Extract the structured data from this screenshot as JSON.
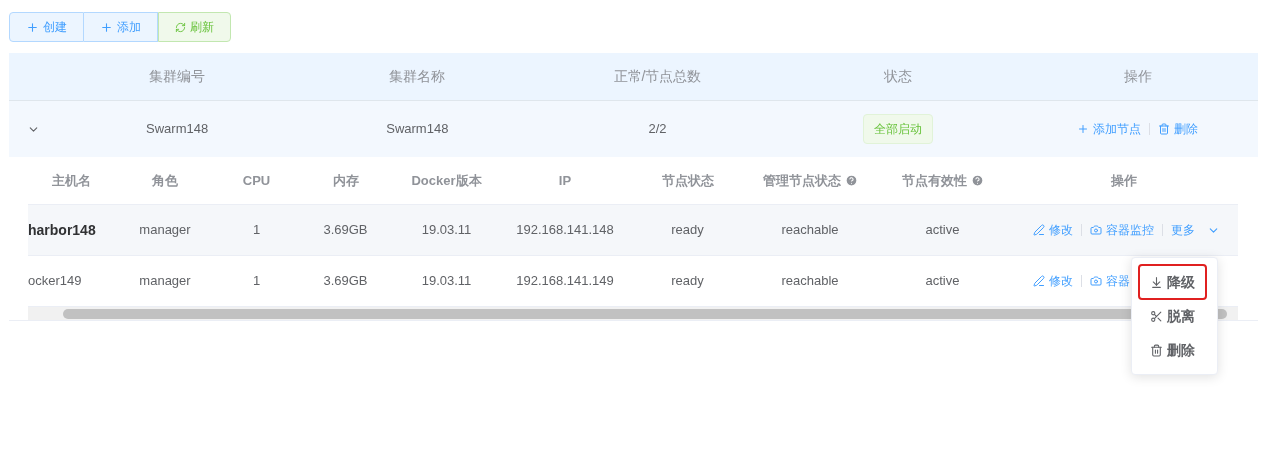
{
  "toolbar": [
    {
      "kind": "add",
      "label": "创建"
    },
    {
      "kind": "add",
      "label": "添加"
    },
    {
      "kind": "refresh",
      "label": "刷新"
    }
  ],
  "cluster_table": {
    "columns": [
      "集群编号",
      "集群名称",
      "正常/节点总数",
      "状态",
      "操作"
    ],
    "rows": [
      {
        "expanded": true,
        "id": "Swarm148",
        "name": "Swarm148",
        "nodes": "2/2",
        "status": "全部启动",
        "actions": [
          {
            "kind": "add",
            "label": "添加节点"
          },
          {
            "kind": "delete",
            "label": "删除"
          }
        ]
      }
    ]
  },
  "node_table": {
    "columns": [
      {
        "label": "主机名",
        "help": false
      },
      {
        "label": "角色",
        "help": false
      },
      {
        "label": "CPU",
        "help": false
      },
      {
        "label": "内存",
        "help": false
      },
      {
        "label": "Docker版本",
        "help": false
      },
      {
        "label": "IP",
        "help": false
      },
      {
        "label": "节点状态",
        "help": false
      },
      {
        "label": "管理节点状态",
        "help": true
      },
      {
        "label": "节点有效性",
        "help": true
      },
      {
        "label": "操作",
        "help": false
      }
    ],
    "rows": [
      {
        "hovered": true,
        "cells": [
          "harbor148",
          "manager",
          "1",
          "3.69GB",
          "19.03.11",
          "192.168.141.148",
          "ready",
          "reachable",
          "active"
        ],
        "actions": [
          {
            "kind": "edit",
            "label": "修改"
          },
          {
            "kind": "monitor",
            "label": "容器监控"
          },
          {
            "kind": "more",
            "label": "更多"
          }
        ]
      },
      {
        "hovered": false,
        "cells": [
          "ocker149",
          "manager",
          "1",
          "3.69GB",
          "19.03.11",
          "192.168.141.149",
          "ready",
          "reachable",
          "active"
        ],
        "actions": [
          {
            "kind": "edit",
            "label": "修改"
          },
          {
            "kind": "monitor",
            "label": "容器"
          }
        ]
      }
    ]
  },
  "more_menu": [
    {
      "kind": "downgrade",
      "label": "降级",
      "highlighted": true
    },
    {
      "kind": "detach",
      "label": "脱离",
      "highlighted": false
    },
    {
      "kind": "delete",
      "label": "删除",
      "highlighted": false
    }
  ]
}
